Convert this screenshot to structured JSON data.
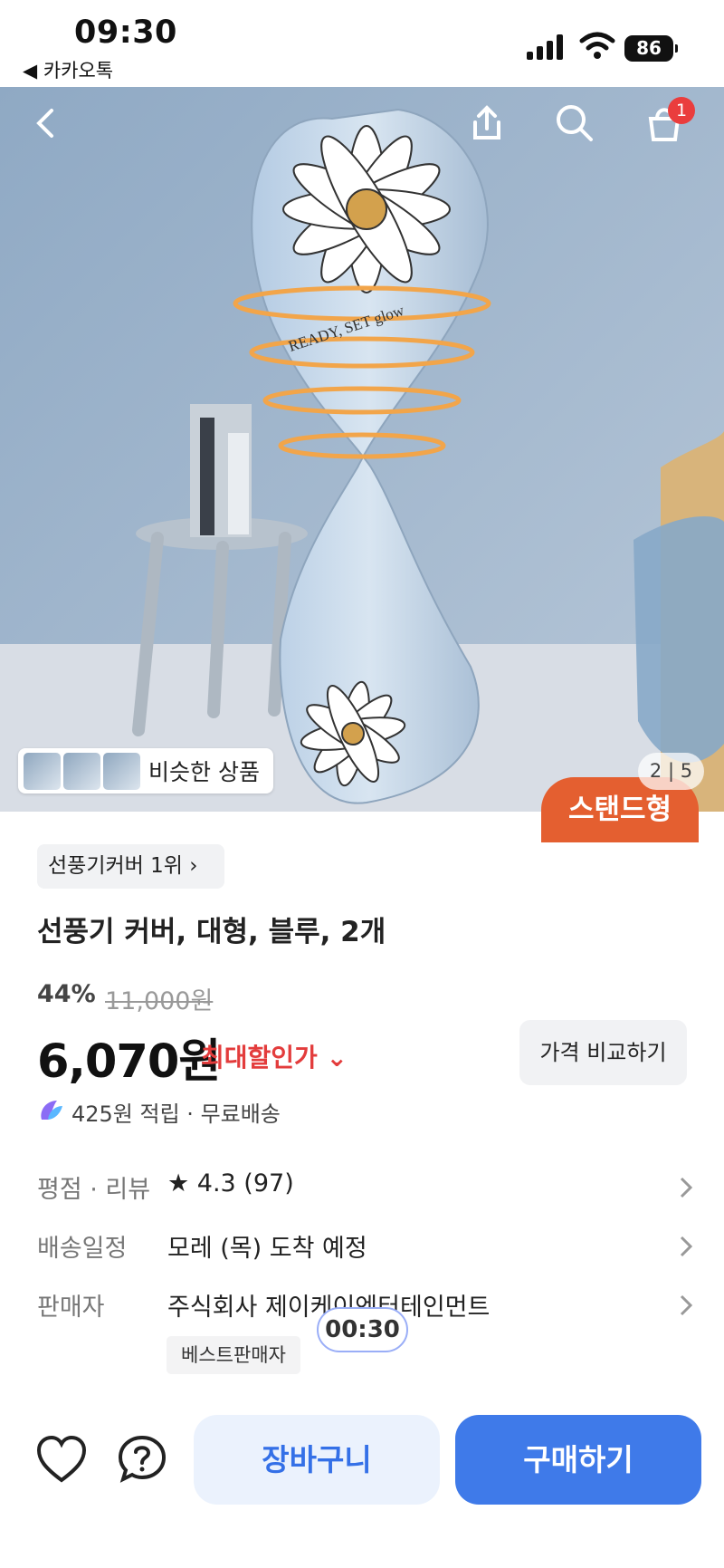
{
  "status_bar": {
    "time": "09:30",
    "back_app": "◀ 카카오톡",
    "battery": "86"
  },
  "header": {
    "cart_count": "1",
    "icons": [
      "back-arrow-icon",
      "share-icon",
      "search-icon",
      "cart-icon"
    ]
  },
  "image": {
    "similar_label": "비슷한 상품",
    "counter": "2 | 5",
    "promo": "스탠드형",
    "watermark": "READY, SET glow"
  },
  "product": {
    "rank_badge": "선풍기커버 1위 ›",
    "title": "선풍기 커버, 대형, 블루, 2개",
    "discount": "44%",
    "original_price": "11,000원",
    "price": "6,070원",
    "max_discount": "최대할인가 ⌄",
    "compare_button": "가격 비교하기",
    "reward": "425원 적립 · 무료배송"
  },
  "info": {
    "rating_label": "평점 · 리뷰",
    "rating_value": "★ 4.3 (97)",
    "delivery_label": "배송일정",
    "delivery_value": "모레 (목) 도착 예정",
    "seller_label": "판매자",
    "seller_value": "주식회사 제이케이엔터테인먼트",
    "seller_badge": "베스트판매자",
    "timer": "00:30"
  },
  "actions": {
    "cart": "장바구니",
    "buy": "구매하기"
  },
  "colors": {
    "accent": "#3f7ae9",
    "discount_red": "#e33c3c",
    "badge_red": "#ea3d3d"
  }
}
